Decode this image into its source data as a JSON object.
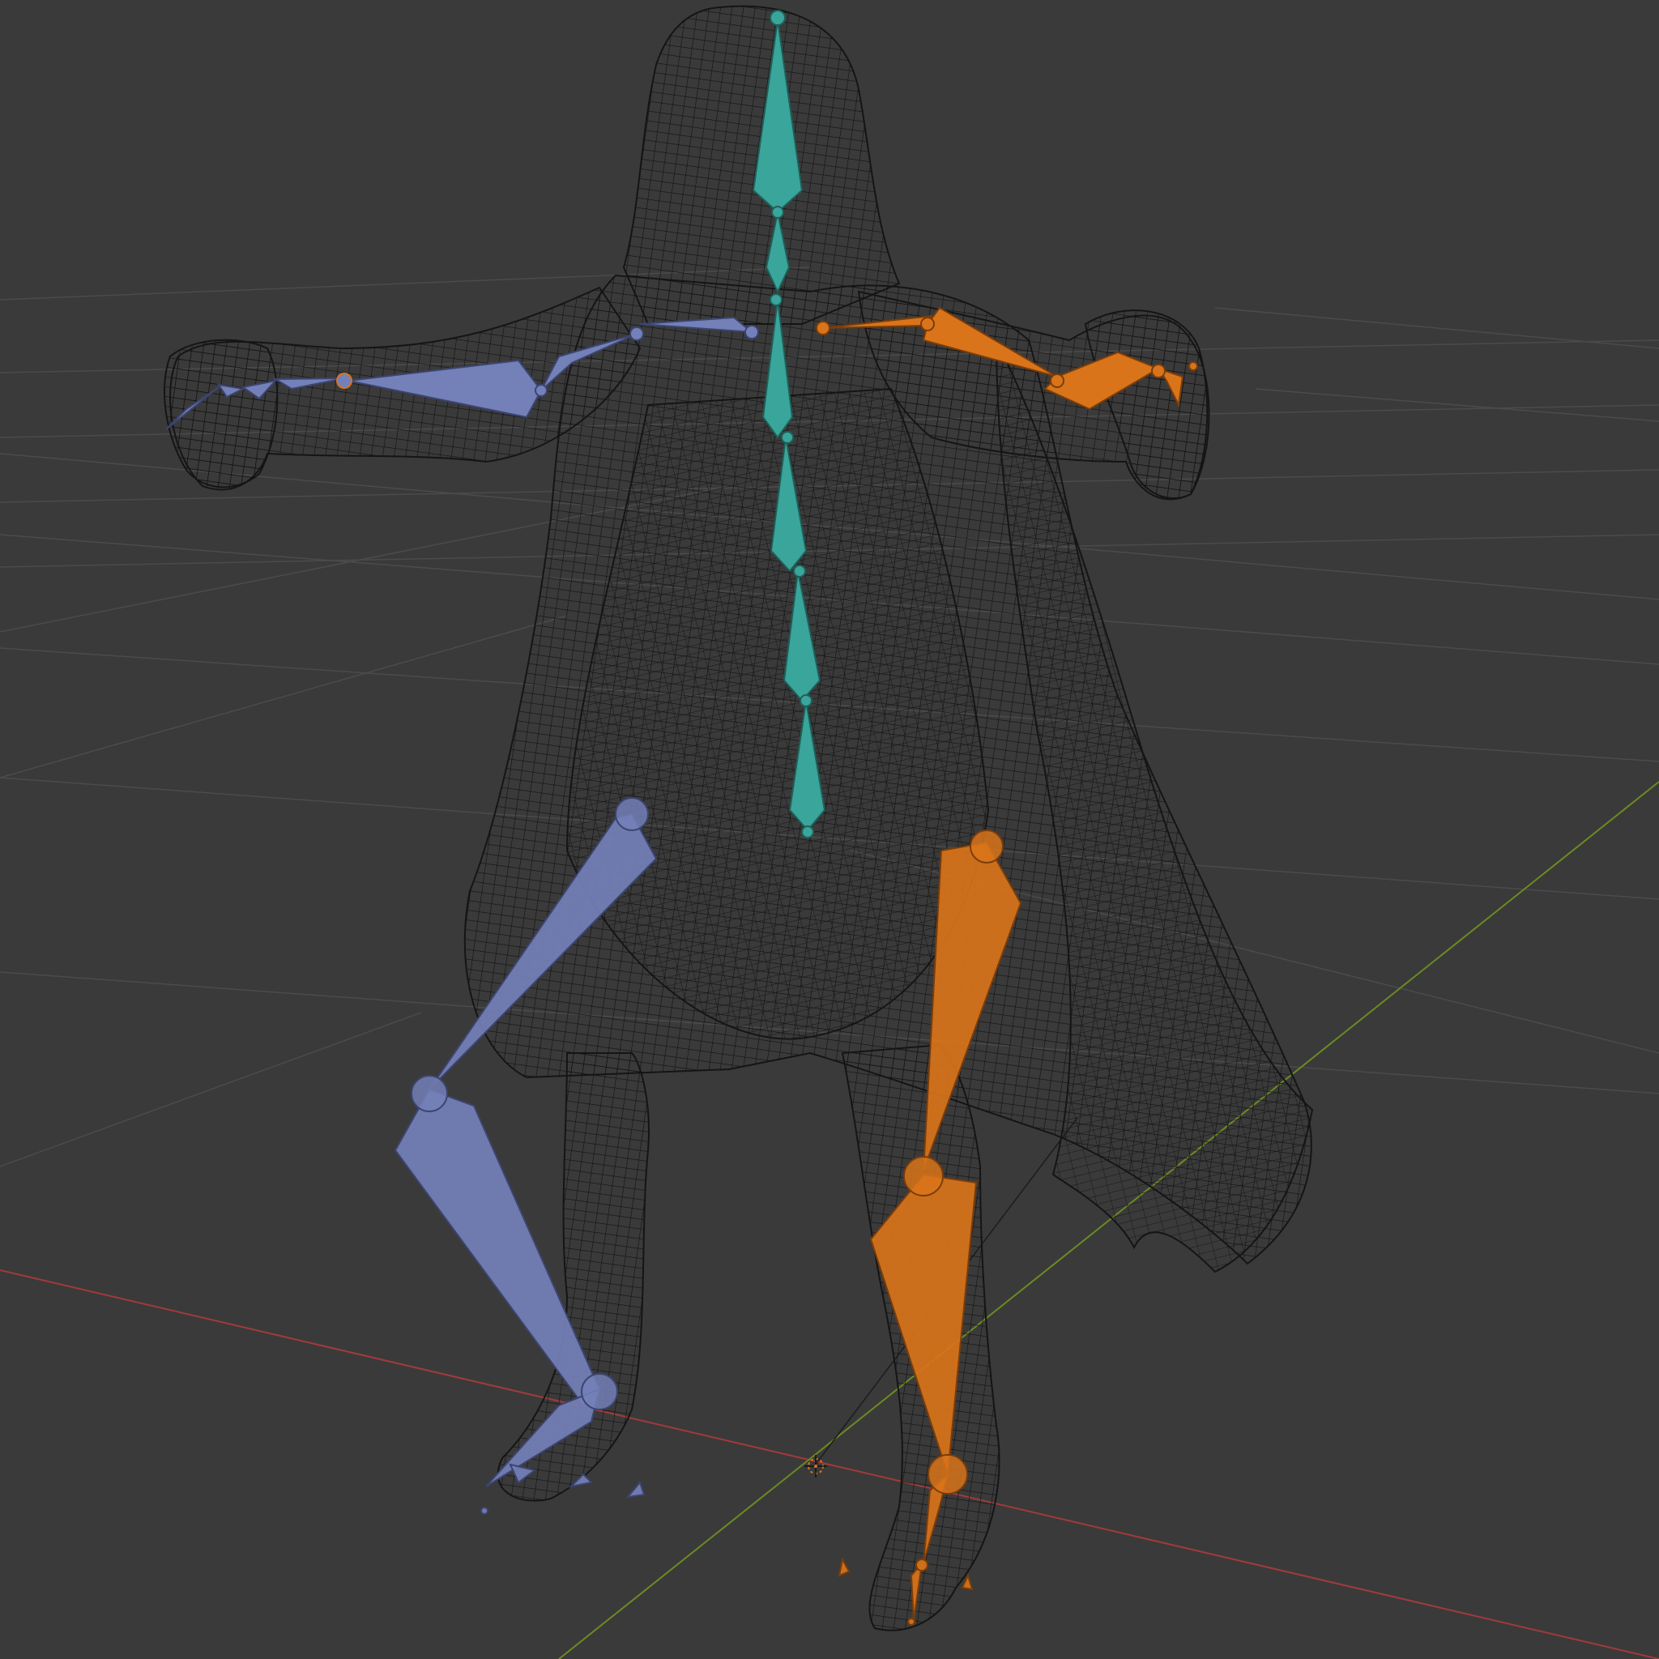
{
  "viewport": {
    "background": "#3a3a3a",
    "view_mode": "wireframe",
    "grid_color": "#4a4a4a",
    "x_axis_color": "#a33a3a",
    "y_axis_color": "#6b8a22"
  },
  "character": {
    "mesh_color": "#141414",
    "mesh_type": "wireframe"
  },
  "armature": {
    "display": "octahedral",
    "colors": {
      "spine": "#3aa59a",
      "left_side": "#7480b8",
      "right_side": "#d9741a"
    },
    "bone_groups": [
      "spine",
      "left-arm",
      "right-arm",
      "left-leg",
      "right-leg"
    ]
  },
  "origin": {
    "icon": "3d-cursor-icon",
    "color": "#d9741a"
  }
}
